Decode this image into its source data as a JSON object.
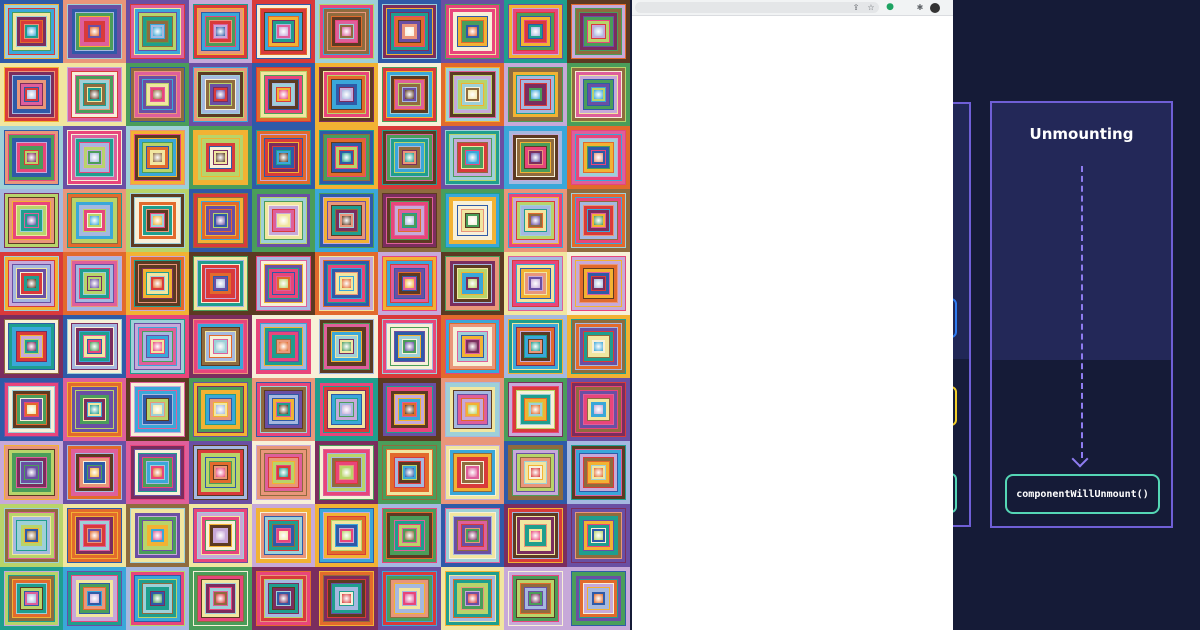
{
  "mosaic": {
    "palette": [
      "#e8457b",
      "#4a9d5a",
      "#f2b233",
      "#6a4fa3",
      "#3aa7d9",
      "#e26a2c",
      "#b8d46a",
      "#8f6b3e",
      "#d93a3a",
      "#2f5aa8",
      "#f1e6a0",
      "#9ed0d8",
      "#c7a9d9",
      "#e9967a",
      "#5c3a22",
      "#1f9e8e",
      "#f7f0d8",
      "#7b2d5e",
      "#a5b8e0",
      "#de5f9b"
    ]
  },
  "browser": {
    "icons": {
      "share": "share-icon",
      "star": "star-icon",
      "extension": "extension-icon",
      "puzzle": "puzzle-icon",
      "avatar": "avatar"
    }
  },
  "diagram": {
    "updating_paren": ")",
    "unmounting": {
      "title": "Unmounting",
      "method": "componentWillUnmount()"
    },
    "colors": {
      "column_border": "#6f5fd6",
      "arrow": "#8e7cf0",
      "method_border": "#55d6b5",
      "blue_box": "#2d7bf0",
      "yellow_box": "#f2cf2b"
    }
  }
}
